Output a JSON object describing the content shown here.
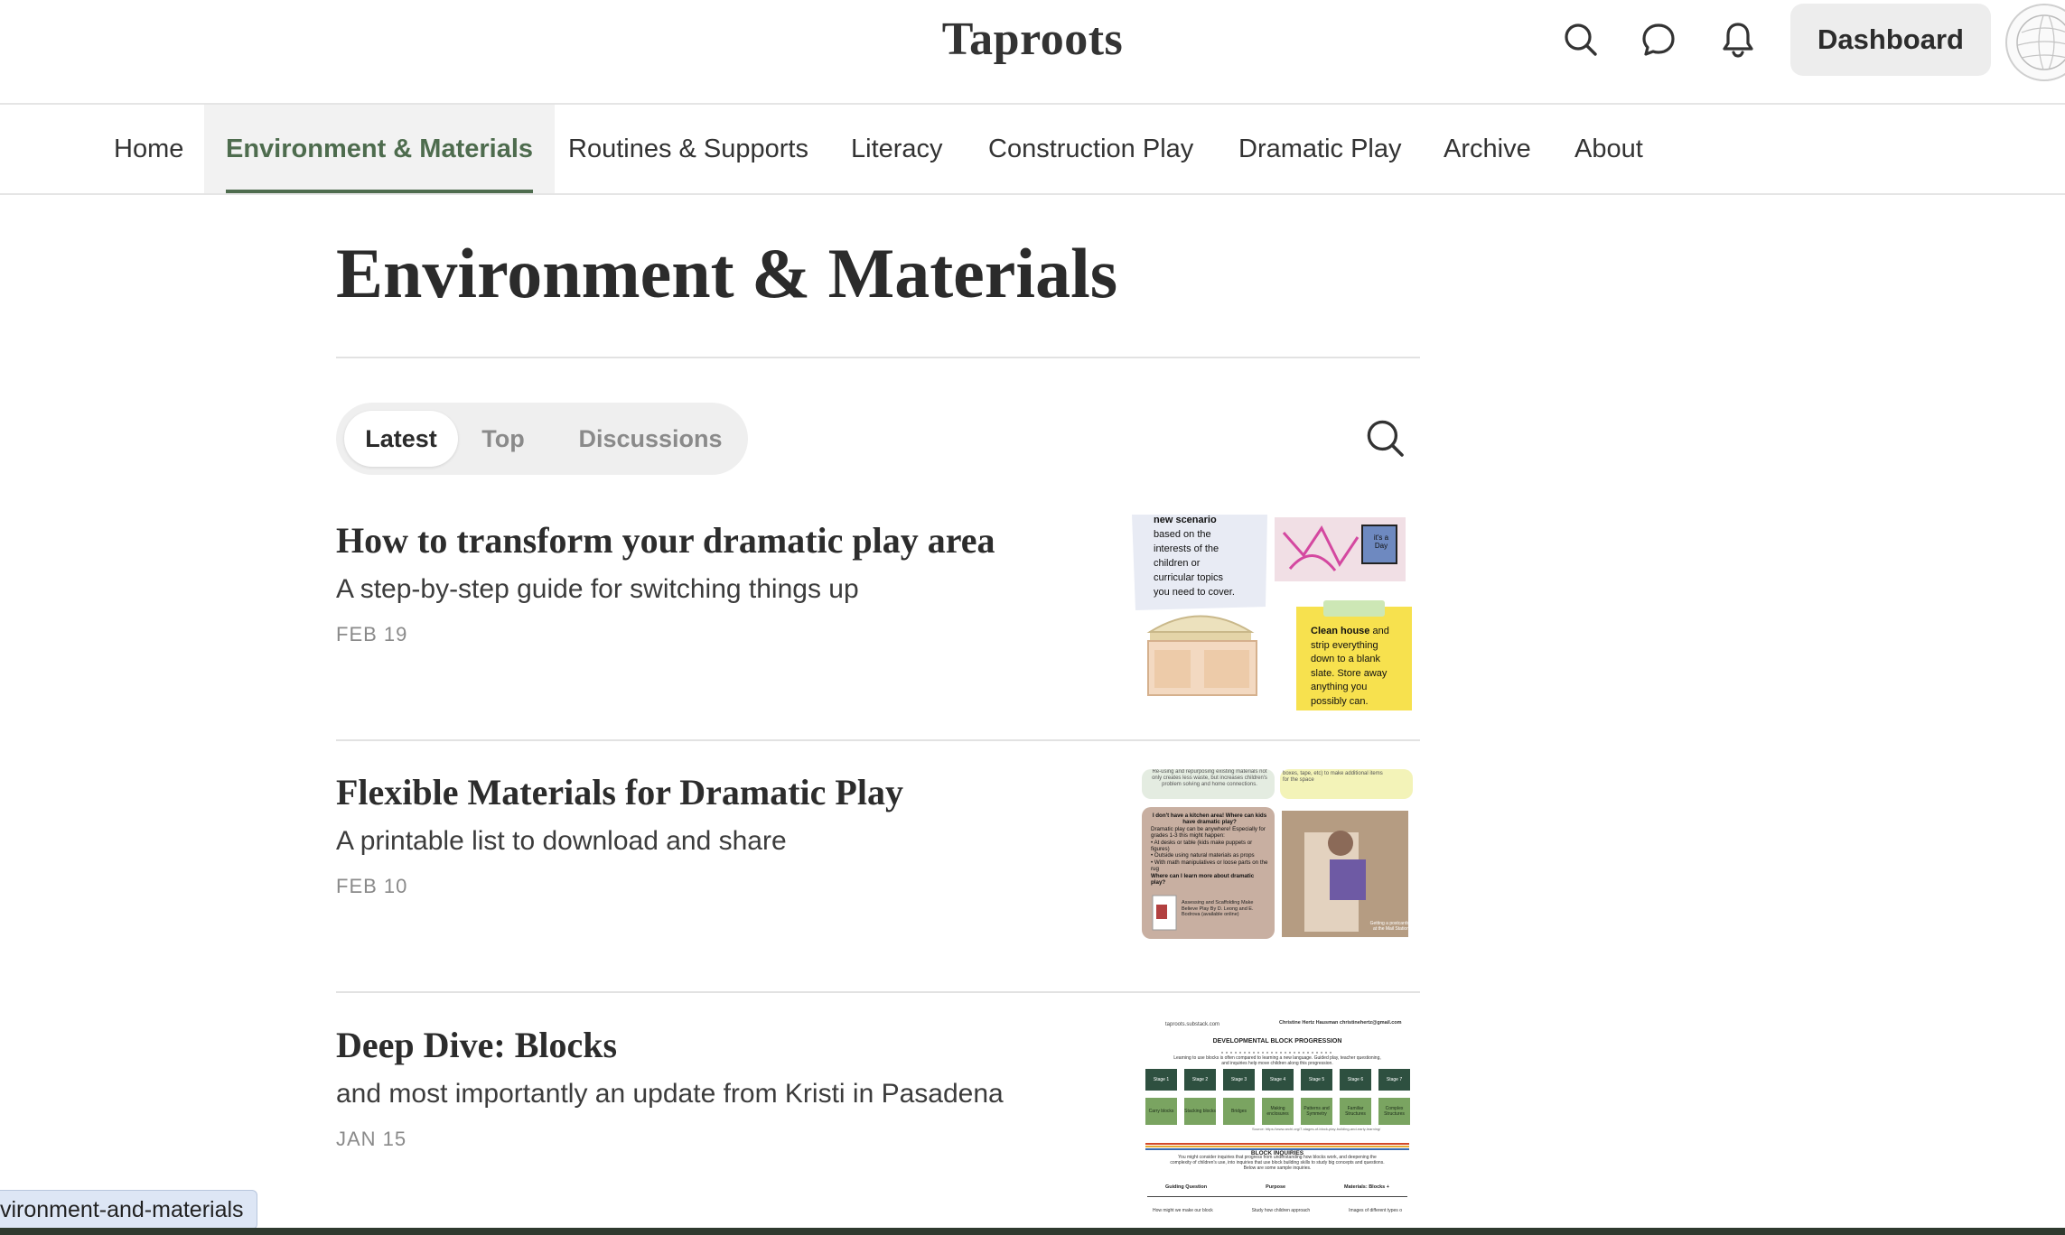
{
  "header": {
    "site_title": "Taproots",
    "dashboard_label": "Dashboard",
    "icons": [
      "search-icon",
      "chat-icon",
      "bell-icon"
    ]
  },
  "nav": {
    "items": [
      {
        "label": "Home"
      },
      {
        "label": "Environment & Materials",
        "active": true
      },
      {
        "label": "Routines & Supports"
      },
      {
        "label": "Literacy"
      },
      {
        "label": "Construction Play"
      },
      {
        "label": "Dramatic Play"
      },
      {
        "label": "Archive"
      },
      {
        "label": "About"
      }
    ],
    "accent_color": "#4e6c4e"
  },
  "page": {
    "title": "Environment & Materials"
  },
  "tabs": [
    {
      "label": "Latest",
      "active": true
    },
    {
      "label": "Top"
    },
    {
      "label": "Discussions"
    }
  ],
  "posts": [
    {
      "title": "How to transform your dramatic play area",
      "subtitle": "A step-by-step guide for switching things up",
      "date": "FEB 19",
      "thumb": {
        "note1": [
          "new scenario",
          "based on the",
          "interests of the",
          "children or",
          "curricular topics",
          "you need to cover."
        ],
        "note2_bold": "Clean house",
        "note2": [
          "and",
          "strip everything",
          "down to a blank",
          "slate. Store away",
          "anything you",
          "possibly can."
        ],
        "sign": "it's a",
        "sign2": "Day"
      }
    },
    {
      "title": "Flexible Materials for Dramatic Play",
      "subtitle": "A printable list to download and share",
      "date": "FEB 10",
      "thumb": {
        "top_left": [
          "Re-using and repurposing existing materials not",
          "only creates less waste, but increases children's",
          "problem solving and home connections."
        ],
        "top_right": [
          "boxes, tape, etc) to make additional items",
          "for the space"
        ],
        "card_heading": "I don't have a kitchen area! Where can kids have dramatic play?",
        "card_lines": [
          "Dramatic play can be anywhere! Especially for",
          "grades 1-3 this might happen:",
          "• At desks or table (kids make puppets or",
          "figures)",
          "• Outside using natural materials as props",
          "• With math manipulatives or loose parts on the",
          "rug"
        ],
        "card_heading2": "Where can I learn more about dramatic play?",
        "card_ref": [
          "Assessing and Scaffolding Make",
          "Believe Play By D. Leong and E.",
          "Bodrova (available online)"
        ],
        "photo_caption": [
          "Getting a postcards",
          "at the Mail Station"
        ]
      }
    },
    {
      "title": "Deep Dive: Blocks",
      "subtitle": "and most importantly an update from Kristi in Pasadena",
      "date": "JAN 15",
      "thumb": {
        "brand": "taproots.substack.com",
        "author": "Christine Hertz Hausman christinehertz@gmail.com",
        "heading": "DEVELOPMENTAL BLOCK PROGRESSION",
        "intro": [
          "Learning to use blocks is often compared to learning a new language. Guided play, teacher questioning,",
          "and inquiries help move children along this progression."
        ],
        "stages": [
          "Stage 1",
          "Stage 2",
          "Stage 3",
          "Stage 4",
          "Stage 5",
          "Stage 6",
          "Stage 7"
        ],
        "stage_desc": [
          "Carry blocks",
          "Stacking blocks",
          "Bridges",
          "Making enclosures",
          "Patterns and Symmetry",
          "Familiar Structures",
          "Complex Structures"
        ],
        "source": "Source: https://www.archi.org/7-stages-of-block-play-building-and-early-learning/",
        "inquiries_heading": "BLOCK INQUIRIES",
        "inquiries_text": [
          "You might consider inquiries that progress from understanding how blocks work, and deepening the",
          "complexity of children's use, into inquiries that use block building skills to study big concepts and questions.",
          "Below are some sample inquiries."
        ],
        "col_headers": [
          "Guiding Question",
          "Purpose",
          "Materials: Blocks +"
        ],
        "row1": [
          "How might we make our block",
          "Study how children approach",
          "Images of different types o"
        ]
      }
    }
  ],
  "status_bar": {
    "url_text": "vironment-and-materials"
  }
}
